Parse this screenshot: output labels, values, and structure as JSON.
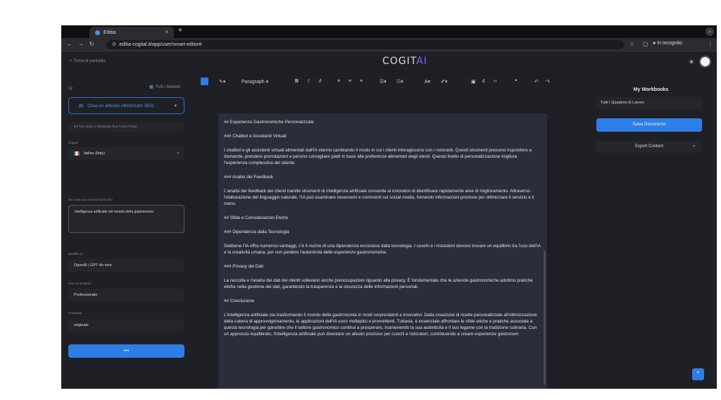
{
  "browser": {
    "tab_title": "Editia",
    "tab_close": "×",
    "new_tab": "+",
    "url": "editia-cogital.it/app/user/smart-editor#",
    "incognito_label": "In incognito"
  },
  "app_header": {
    "back_link": "< Torna al pannello",
    "logo_main": "COGIT",
    "logo_accent": "AI"
  },
  "left_panel": {
    "all_models_label": "Tutti i Modelli",
    "create_button_label": "Crea un articolo ottimizzato SEO",
    "tip_text": "Il Tuo Stalco è Miniilosta Tina Tume Possie",
    "language_label": "Lingua",
    "language_value": "Italian (Italy)",
    "topic_label": "Su cosa vuoi scrivere l'articolo?",
    "topic_value": "Intelligenza artificiale nel mondo della gastronomia",
    "model_label": "Modello IA",
    "model_value": "OpenAI | GPT 4o mini",
    "tone_label": "Tono di scrittura",
    "tone_value": "Professionale",
    "creativity_label": "Creatività",
    "creativity_value": "originale",
    "generate_button_label": "•••"
  },
  "toolbar": {
    "paragraph_select": "Paragraph",
    "bold": "B",
    "italic": "I",
    "quote": "❞",
    "undo": "↶",
    "redo": "↷"
  },
  "editor": {
    "paragraphs": [
      "## Esperienze Gastronomiche Personalizzate",
      "### Chatbot e Assistenti Virtuali",
      "I chatbot e gli assistenti virtuali alimentati dall'IA stanno cambiando il modo in cui i clienti interagiscono con i ristoranti. Questi strumenti possono rispondere a domande, prendere prenotazioni e persino consigliare piatti in base alle preferenze alimentari degli utenti. Questo livello di personalizzazione migliora l'esperienza complessiva del cliente.",
      "### Analisi dei Feedback",
      "L'analisi dei feedback dei clienti tramite strumenti di intelligenza artificiale consente ai ristoratori di identificare rapidamente aree di miglioramento. Attraverso l'elaborazione del linguaggio naturale, l'IA può esaminare recensioni e commenti sui social media, fornendo informazioni preziose per ottimizzare il servizio e il menu.",
      "## Sfide e Considerazioni Etiche",
      "### Dipendenza dalla Tecnologia",
      "Sebbene l'IA offra numerosi vantaggi, c'è il rischio di una dipendenza eccessiva dalla tecnologia. I cuochi e i ristoratori devono trovare un equilibrio tra l'uso dell'IA e la creatività umana, per non perdere l'autenticità delle esperienze gastronomiche.",
      "### Privacy dei Dati",
      "La raccolta e l'analisi dei dati dei clienti sollevano anche preoccupazioni riguardo alla privacy. È fondamentale che le aziende gastronomiche adottino pratiche etiche nella gestione dei dati, garantendo la trasparenza e la sicurezza delle informazioni personali.",
      "## Conclusione",
      "L'intelligenza artificiale sta trasformando il mondo della gastronomia in modi sorprendenti e innovativi. Dalla creazione di ricette personalizzate all'ottimizzazione della catena di approvvigionamento, le applicazioni dell'IA sono molteplici e promettenti. Tuttavia, è essenziale affrontare le sfide etiche e pratiche associate a questa tecnologia per garantire che il settore gastronomico continui a prosperare, mantenendo la sua autenticità e il suo legame con la tradizione culinaria. Con un approccio equilibrato, l'intelligenza artificiale può diventare un alleato prezioso per cuochi e ristoratori, contribuendo a creare esperienze gastronom"
    ]
  },
  "right_panel": {
    "title": "My Workbooks",
    "workbook_select": "Tutti I Quaderni di Lavoro",
    "save_button": "Salva Documento",
    "export_button": "Export Content"
  },
  "colors": {
    "accent": "#2e7ee8",
    "logo_accent": "#7b6cf6",
    "background": "#1f2025",
    "editor_bg": "#2a2d3a"
  }
}
